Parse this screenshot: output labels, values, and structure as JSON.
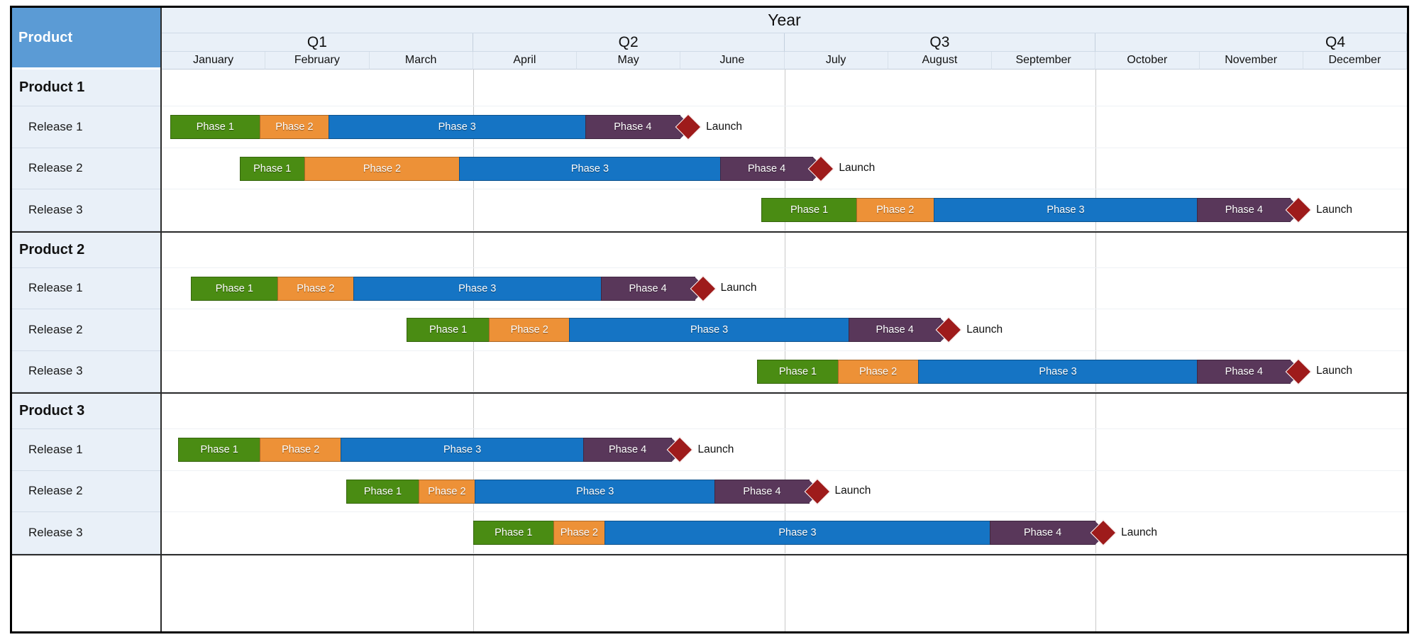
{
  "sidebar": {
    "header_label": "Product",
    "header_color": "#5b9bd5"
  },
  "header": {
    "year_label": "Year",
    "quarters": [
      {
        "label": "Q1",
        "months": [
          "January",
          "February",
          "March"
        ]
      },
      {
        "label": "Q2",
        "months": [
          "April",
          "May",
          "June"
        ]
      },
      {
        "label": "Q3",
        "months": [
          "July",
          "August",
          "September"
        ]
      },
      {
        "label": "Q4",
        "months": [
          "October",
          "November",
          "December"
        ]
      }
    ],
    "months": [
      "January",
      "February",
      "March",
      "April",
      "May",
      "June",
      "July",
      "August",
      "September",
      "October",
      "November",
      "December"
    ]
  },
  "phase_colors": {
    "phase1": "#4a8c13",
    "phase2": "#ed9137",
    "phase3": "#1574c4",
    "phase4": "#59375a",
    "milestone": "#9e1b1b"
  },
  "milestone_label": "Launch",
  "chart_data": {
    "type": "bar",
    "title": "Year",
    "xlabel": "",
    "ylabel": "Product",
    "x_axis_unit": "month",
    "x_axis_range": [
      0,
      12
    ],
    "grid": true,
    "legend": "none",
    "products": [
      {
        "name": "Product 1",
        "releases": [
          {
            "name": "Release 1",
            "phases": [
              {
                "label": "Phase 1",
                "color": "phase1",
                "start": 0.08,
                "end": 0.95
              },
              {
                "label": "Phase 2",
                "color": "phase2",
                "start": 0.95,
                "end": 1.62
              },
              {
                "label": "Phase 3",
                "color": "phase3",
                "start": 1.62,
                "end": 4.1
              },
              {
                "label": "Phase 4",
                "color": "phase4",
                "start": 4.1,
                "end": 5.02
              }
            ],
            "milestone": {
              "label": "Launch",
              "at": 5.02
            }
          },
          {
            "name": "Release 2",
            "phases": [
              {
                "label": "Phase 1",
                "color": "phase1",
                "start": 0.75,
                "end": 1.38
              },
              {
                "label": "Phase 2",
                "color": "phase2",
                "start": 1.38,
                "end": 2.88
              },
              {
                "label": "Phase 3",
                "color": "phase3",
                "start": 2.88,
                "end": 5.4
              },
              {
                "label": "Phase 4",
                "color": "phase4",
                "start": 5.4,
                "end": 6.3
              }
            ],
            "milestone": {
              "label": "Launch",
              "at": 6.3
            }
          },
          {
            "name": "Release 3",
            "phases": [
              {
                "label": "Phase 1",
                "color": "phase1",
                "start": 5.78,
                "end": 6.7
              },
              {
                "label": "Phase 2",
                "color": "phase2",
                "start": 6.7,
                "end": 7.45
              },
              {
                "label": "Phase 3",
                "color": "phase3",
                "start": 7.45,
                "end": 10.0
              },
              {
                "label": "Phase 4",
                "color": "phase4",
                "start": 10.0,
                "end": 10.9
              }
            ],
            "milestone": {
              "label": "Launch",
              "at": 10.9
            }
          }
        ]
      },
      {
        "name": "Product 2",
        "releases": [
          {
            "name": "Release 1",
            "phases": [
              {
                "label": "Phase 1",
                "color": "phase1",
                "start": 0.28,
                "end": 1.12
              },
              {
                "label": "Phase 2",
                "color": "phase2",
                "start": 1.12,
                "end": 1.86
              },
              {
                "label": "Phase 3",
                "color": "phase3",
                "start": 1.86,
                "end": 4.25
              },
              {
                "label": "Phase 4",
                "color": "phase4",
                "start": 4.25,
                "end": 5.16
              }
            ],
            "milestone": {
              "label": "Launch",
              "at": 5.16
            }
          },
          {
            "name": "Release 2",
            "phases": [
              {
                "label": "Phase 1",
                "color": "phase1",
                "start": 2.36,
                "end": 3.16
              },
              {
                "label": "Phase 2",
                "color": "phase2",
                "start": 3.16,
                "end": 3.94
              },
              {
                "label": "Phase 3",
                "color": "phase3",
                "start": 3.94,
                "end": 6.64
              },
              {
                "label": "Phase 4",
                "color": "phase4",
                "start": 6.64,
                "end": 7.53
              }
            ],
            "milestone": {
              "label": "Launch",
              "at": 7.53
            }
          },
          {
            "name": "Release 3",
            "phases": [
              {
                "label": "Phase 1",
                "color": "phase1",
                "start": 5.74,
                "end": 6.52
              },
              {
                "label": "Phase 2",
                "color": "phase2",
                "start": 6.52,
                "end": 7.3
              },
              {
                "label": "Phase 3",
                "color": "phase3",
                "start": 7.3,
                "end": 10.0
              },
              {
                "label": "Phase 4",
                "color": "phase4",
                "start": 10.0,
                "end": 10.9
              }
            ],
            "milestone": {
              "label": "Launch",
              "at": 10.9
            }
          }
        ]
      },
      {
        "name": "Product 3",
        "releases": [
          {
            "name": "Release 1",
            "phases": [
              {
                "label": "Phase 1",
                "color": "phase1",
                "start": 0.16,
                "end": 0.95
              },
              {
                "label": "Phase 2",
                "color": "phase2",
                "start": 0.95,
                "end": 1.74
              },
              {
                "label": "Phase 3",
                "color": "phase3",
                "start": 1.74,
                "end": 4.08
              },
              {
                "label": "Phase 4",
                "color": "phase4",
                "start": 4.08,
                "end": 4.94
              }
            ],
            "milestone": {
              "label": "Launch",
              "at": 4.94
            }
          },
          {
            "name": "Release 2",
            "phases": [
              {
                "label": "Phase 1",
                "color": "phase1",
                "start": 1.78,
                "end": 2.48
              },
              {
                "label": "Phase 2",
                "color": "phase2",
                "start": 2.48,
                "end": 3.03
              },
              {
                "label": "Phase 3",
                "color": "phase3",
                "start": 3.03,
                "end": 5.35
              },
              {
                "label": "Phase 4",
                "color": "phase4",
                "start": 5.35,
                "end": 6.26
              }
            ],
            "milestone": {
              "label": "Launch",
              "at": 6.26
            }
          },
          {
            "name": "Release 3",
            "phases": [
              {
                "label": "Phase 1",
                "color": "phase1",
                "start": 3.0,
                "end": 3.78
              },
              {
                "label": "Phase 2",
                "color": "phase2",
                "start": 3.78,
                "end": 4.28
              },
              {
                "label": "Phase 3",
                "color": "phase3",
                "start": 4.28,
                "end": 8.0
              },
              {
                "label": "Phase 4",
                "color": "phase4",
                "start": 8.0,
                "end": 9.02
              }
            ],
            "milestone": {
              "label": "Launch",
              "at": 9.02
            }
          }
        ]
      }
    ]
  }
}
